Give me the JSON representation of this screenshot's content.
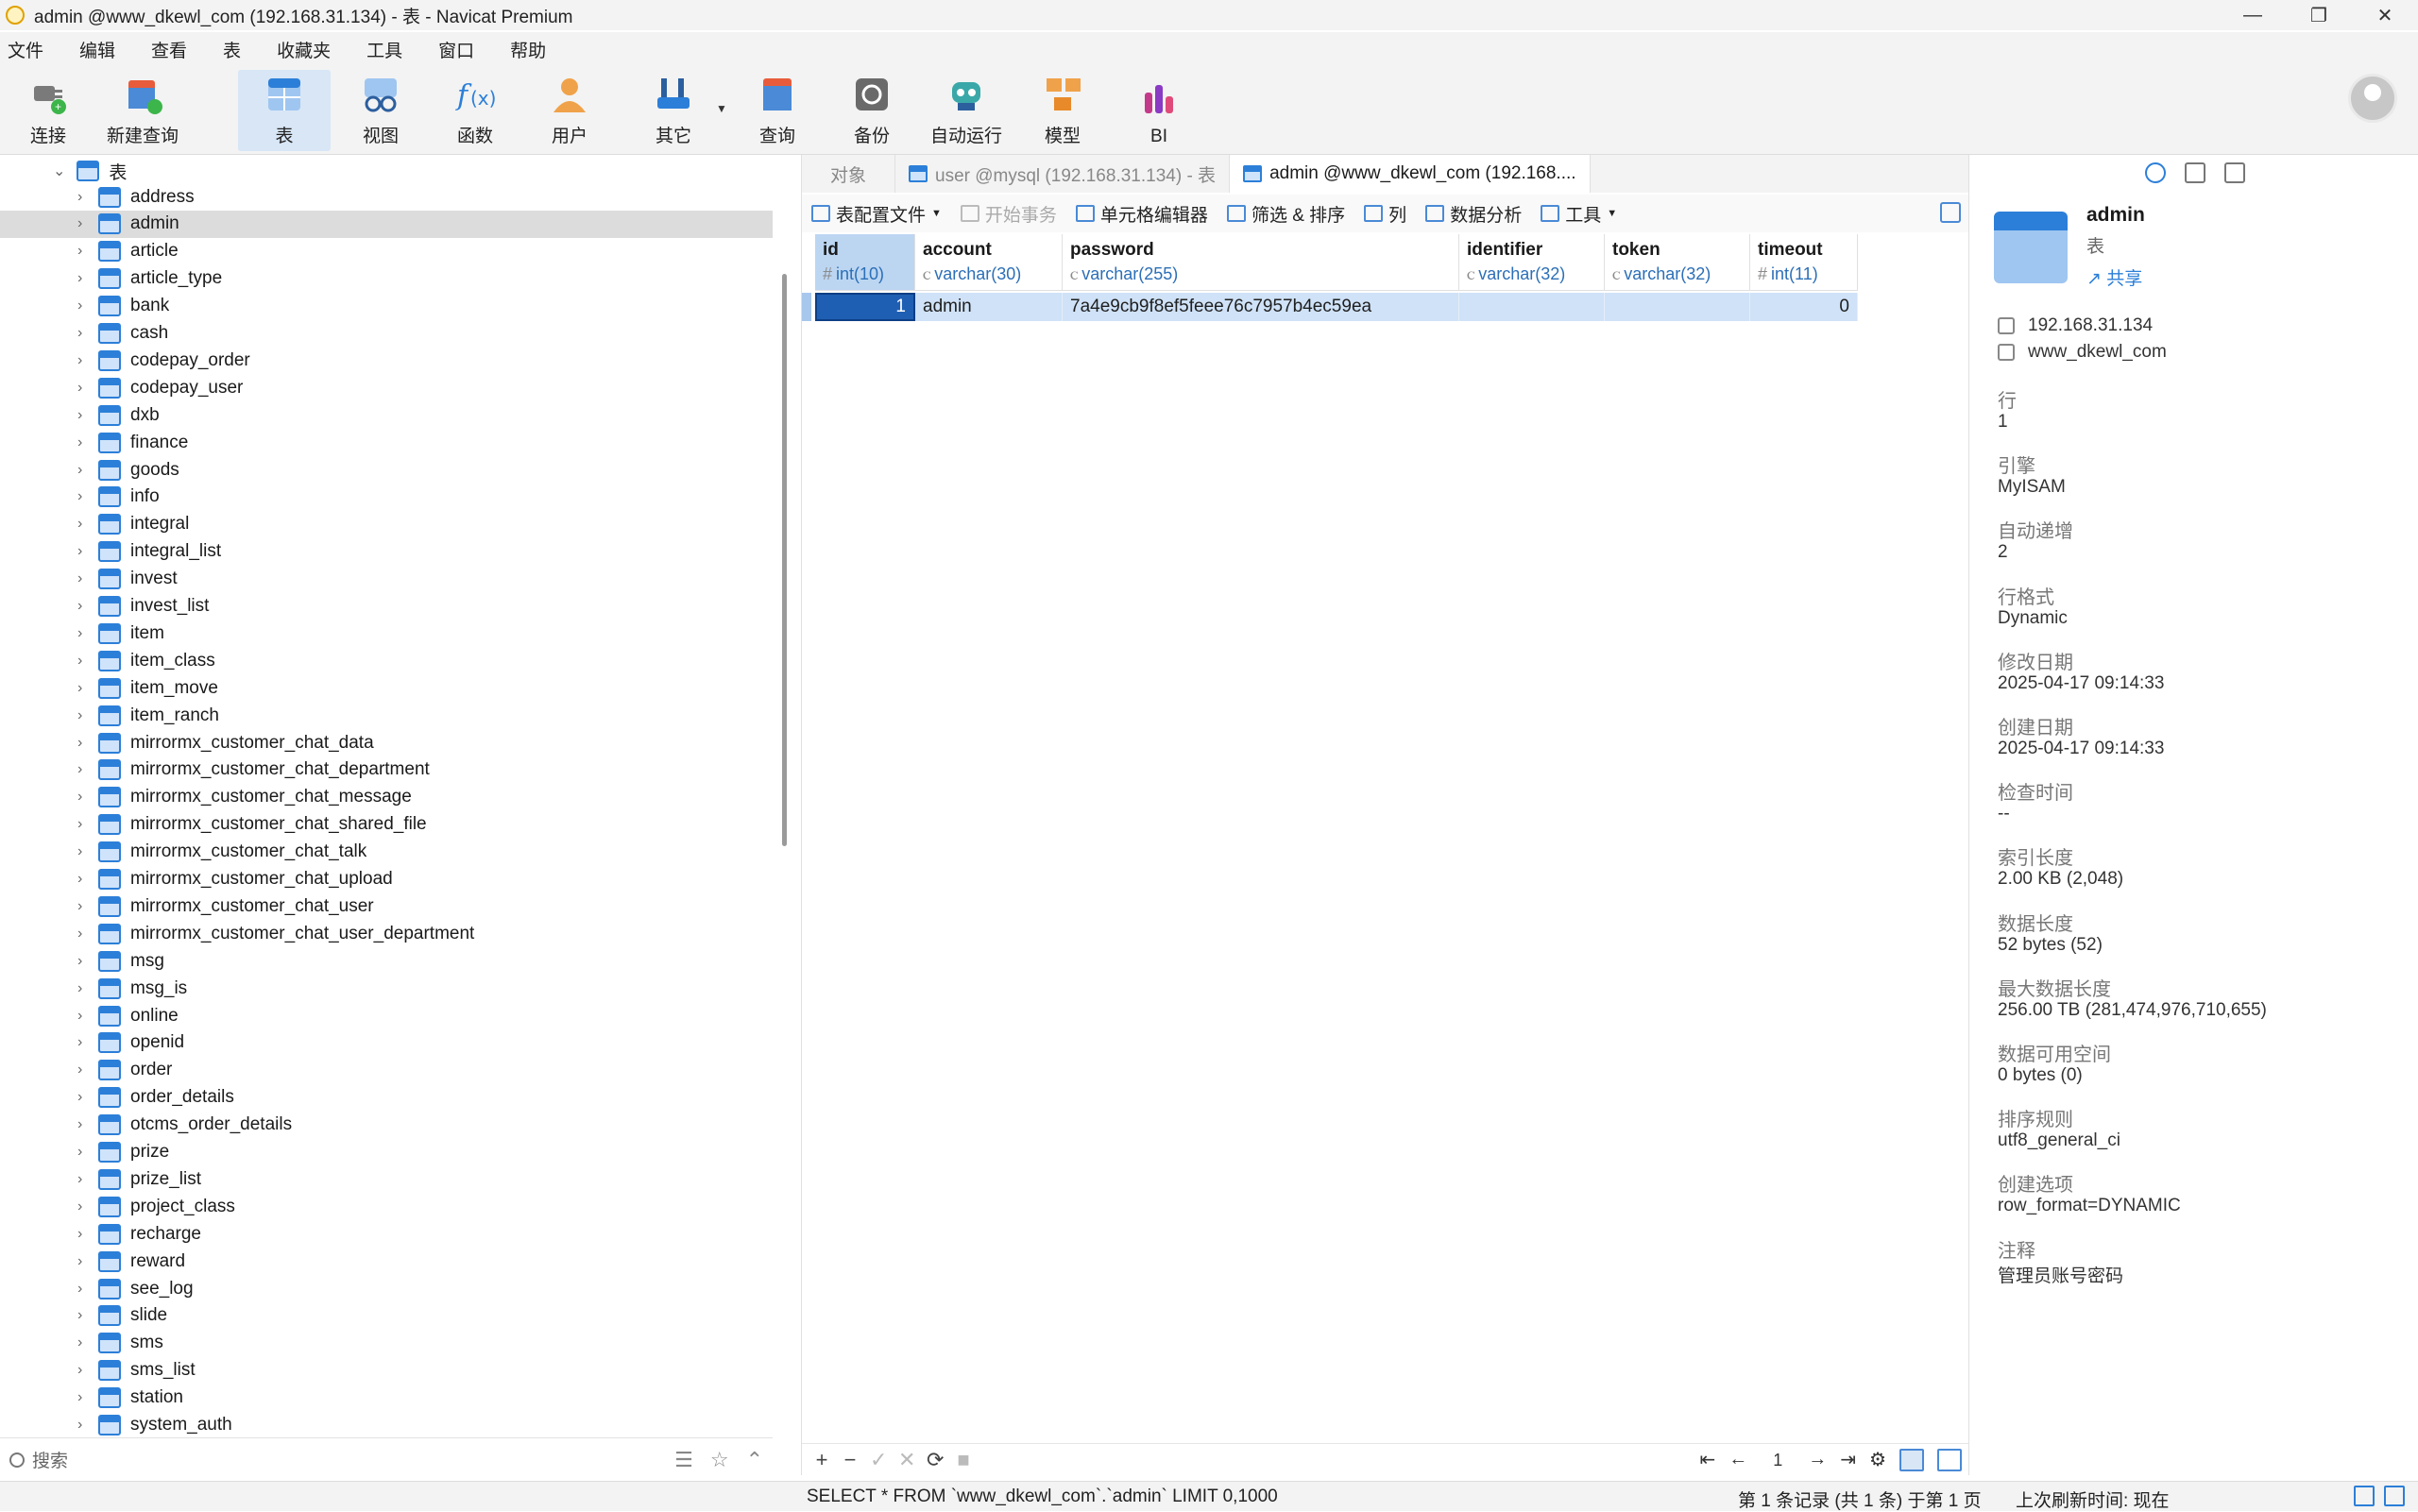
{
  "window": {
    "title": "admin @www_dkewl_com (192.168.31.134) - 表 - Navicat Premium",
    "controls": [
      "—",
      "❐",
      "✕"
    ]
  },
  "menu": [
    "文件",
    "编辑",
    "查看",
    "表",
    "收藏夹",
    "工具",
    "窗口",
    "帮助"
  ],
  "toolbar": [
    {
      "label": "连接",
      "icon": "plug-connect-icon"
    },
    {
      "label": "新建查询",
      "icon": "new-query-icon"
    },
    {
      "label": "表",
      "icon": "table-icon",
      "active": true
    },
    {
      "label": "视图",
      "icon": "view-glasses-icon"
    },
    {
      "label": "函数",
      "icon": "function-fx-icon"
    },
    {
      "label": "用户",
      "icon": "user-icon"
    },
    {
      "label": "其它",
      "icon": "tools-icon"
    },
    {
      "label": "查询",
      "icon": "query-icon"
    },
    {
      "label": "备份",
      "icon": "backup-icon"
    },
    {
      "label": "自动运行",
      "icon": "robot-icon"
    },
    {
      "label": "模型",
      "icon": "model-icon"
    },
    {
      "label": "BI",
      "icon": "bi-icon"
    }
  ],
  "tree": {
    "root_label": "表",
    "selected": "admin",
    "tables": [
      "address",
      "admin",
      "article",
      "article_type",
      "bank",
      "cash",
      "codepay_order",
      "codepay_user",
      "dxb",
      "finance",
      "goods",
      "info",
      "integral",
      "integral_list",
      "invest",
      "invest_list",
      "item",
      "item_class",
      "item_move",
      "item_ranch",
      "mirrormx_customer_chat_data",
      "mirrormx_customer_chat_department",
      "mirrormx_customer_chat_message",
      "mirrormx_customer_chat_shared_file",
      "mirrormx_customer_chat_talk",
      "mirrormx_customer_chat_upload",
      "mirrormx_customer_chat_user",
      "mirrormx_customer_chat_user_department",
      "msg",
      "msg_is",
      "online",
      "openid",
      "order",
      "order_details",
      "otcms_order_details",
      "prize",
      "prize_list",
      "project_class",
      "recharge",
      "reward",
      "see_log",
      "slide",
      "sms",
      "sms_list",
      "station",
      "system_auth"
    ]
  },
  "search": {
    "placeholder": "搜索"
  },
  "tabs": [
    {
      "label": "对象",
      "active": false
    },
    {
      "label": "user @mysql (192.168.31.134) - 表",
      "active": false
    },
    {
      "label": "admin @www_dkewl_com (192.168....",
      "active": true
    }
  ],
  "subtoolbar": [
    {
      "label": "表配置文件",
      "disabled": false,
      "dropdown": true
    },
    {
      "label": "开始事务",
      "disabled": true
    },
    {
      "label": "单元格编辑器",
      "disabled": false
    },
    {
      "label": "筛选 & 排序",
      "disabled": false
    },
    {
      "label": "列",
      "disabled": false
    },
    {
      "label": "数据分析",
      "disabled": false
    },
    {
      "label": "工具",
      "disabled": false,
      "dropdown": true
    }
  ],
  "grid": {
    "columns": [
      {
        "name": "id",
        "type": "int(10)",
        "type_icon": "#"
      },
      {
        "name": "account",
        "type": "varchar(30)",
        "type_icon": "ꮯ"
      },
      {
        "name": "password",
        "type": "varchar(255)",
        "type_icon": "ꮯ"
      },
      {
        "name": "identifier",
        "type": "varchar(32)",
        "type_icon": "ꮯ"
      },
      {
        "name": "token",
        "type": "varchar(32)",
        "type_icon": "ꮯ"
      },
      {
        "name": "timeout",
        "type": "int(11)",
        "type_icon": "#"
      }
    ],
    "rows": [
      [
        "1",
        "admin",
        "7a4e9cb9f8ef5feee76c7957b4ec59ea",
        "",
        "",
        "0"
      ]
    ]
  },
  "bottom": {
    "actions": [
      "+",
      "−",
      "✓",
      "✕",
      "⟳",
      "■"
    ],
    "page": "1"
  },
  "info": {
    "name": "admin",
    "type": "表",
    "share": "共享",
    "host": "192.168.31.134",
    "database": "www_dkewl_com",
    "props": [
      {
        "label": "行",
        "value": "1"
      },
      {
        "label": "引擎",
        "value": "MyISAM"
      },
      {
        "label": "自动递增",
        "value": "2"
      },
      {
        "label": "行格式",
        "value": "Dynamic"
      },
      {
        "label": "修改日期",
        "value": "2025-04-17 09:14:33"
      },
      {
        "label": "创建日期",
        "value": "2025-04-17 09:14:33"
      },
      {
        "label": "检查时间",
        "value": "--"
      },
      {
        "label": "索引长度",
        "value": "2.00 KB (2,048)"
      },
      {
        "label": "数据长度",
        "value": "52 bytes (52)"
      },
      {
        "label": "最大数据长度",
        "value": "256.00 TB (281,474,976,710,655)"
      },
      {
        "label": "数据可用空间",
        "value": "0 bytes (0)"
      },
      {
        "label": "排序规则",
        "value": "utf8_general_ci"
      },
      {
        "label": "创建选项",
        "value": "row_format=DYNAMIC"
      },
      {
        "label": "注释",
        "value": "管理员账号密码"
      }
    ]
  },
  "status": {
    "sql": "SELECT * FROM `www_dkewl_com`.`admin` LIMIT 0,1000",
    "records": "第 1 条记录 (共 1 条) 于第 1 页",
    "refresh": "上次刷新时间: 现在"
  }
}
